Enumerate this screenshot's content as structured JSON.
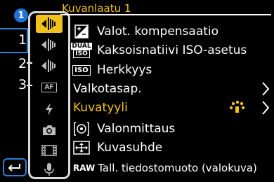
{
  "menu": {
    "title": "Kuvanlaatu 1",
    "active_page_badge": "1",
    "pages": [
      "1",
      "2",
      "3"
    ]
  },
  "tabs": [
    {
      "icon": "photo-quality-icon",
      "active": true
    },
    {
      "icon": "photo-quality-icon",
      "active": false
    },
    {
      "icon": "photo-quality-icon",
      "active": false
    },
    {
      "icon": "af-icon",
      "label": "AF",
      "active": false
    },
    {
      "icon": "flash-icon",
      "active": false
    },
    {
      "icon": "camera-icon",
      "active": false
    },
    {
      "icon": "film-icon",
      "active": false
    },
    {
      "icon": "microphone-icon",
      "active": false
    }
  ],
  "items": [
    {
      "label": "Valot. kompensaatio",
      "icon": "exposure-compensation-icon"
    },
    {
      "label": "Kaksoisnatiivi ISO-asetus",
      "icon": "dual-iso-icon",
      "icon_text_top": "DUAL",
      "icon_text_bottom": "ISO"
    },
    {
      "label": "Herkkyys",
      "icon": "iso-icon",
      "icon_text": "ISO"
    },
    {
      "label": "Valkotasap.",
      "icon": "",
      "has_submenu": true
    },
    {
      "label": "Kuvatyyli",
      "icon": "",
      "has_submenu": true,
      "highlighted": true,
      "value_icon": "photo-style-standard-icon"
    },
    {
      "label": "Valonmittaus",
      "icon": "metering-icon"
    },
    {
      "label": "Kuvasuhde",
      "icon": "aspect-ratio-icon"
    },
    {
      "label": "Tall. tiedostomuoto (valokuva)",
      "icon": "raw-icon",
      "icon_text": "RAW"
    }
  ],
  "colors": {
    "accent": "#f2c21c",
    "selection_border": "#2f7fd8",
    "page_badge": "#1e73d8",
    "background": "#000000"
  }
}
